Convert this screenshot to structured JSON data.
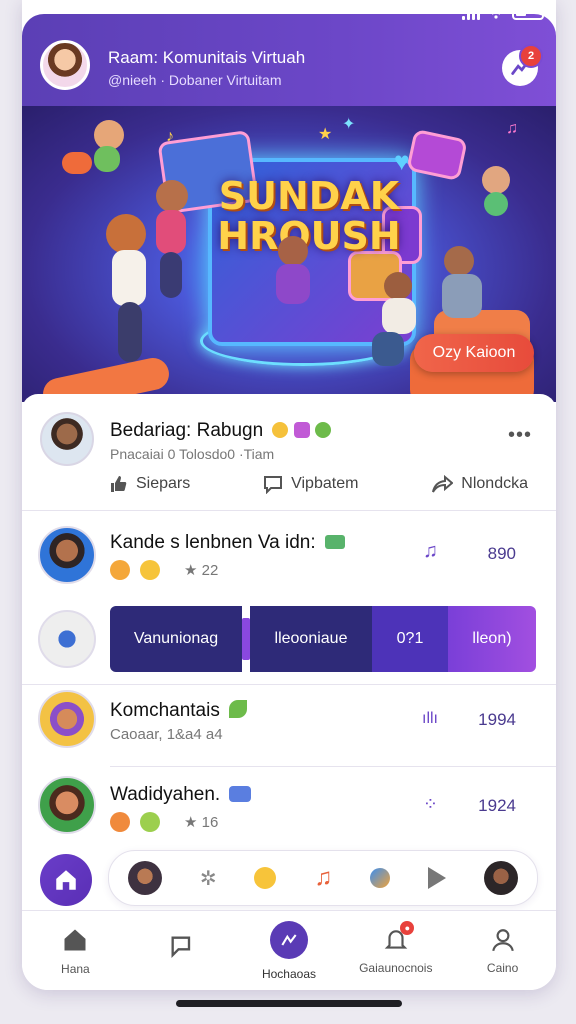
{
  "header": {
    "title": "Raam: Komunitais Virtuah",
    "subtitle": "@nieeh · Dobaner Virtuitam",
    "notification_count": "2"
  },
  "banner": {
    "title_line1": "SUNDAK",
    "title_line2": "HROUSH",
    "cta_label": "Ozy Kaioon"
  },
  "post": {
    "title": "Bedariag: Rabugn",
    "subtitle": "Pnacaiai 0 Tolosdo0 ·Tiam",
    "actions": [
      {
        "label": "Siepars",
        "icon": "thumbs-up-icon"
      },
      {
        "label": "Vipbatem",
        "icon": "comment-icon"
      },
      {
        "label": "Nlondcka",
        "icon": "share-icon"
      }
    ]
  },
  "rows": [
    {
      "title": "Kande s lenbnen Va idn:",
      "meta": "★ 22",
      "right": "890",
      "icon": "music-note-icon"
    },
    {
      "title": "Komchantais",
      "meta": "Caoaar, 1&a4 a4",
      "right": "1994",
      "icon": "equalizer-icon"
    },
    {
      "title": "Wadidyahen.",
      "meta": "★ 16",
      "right": "1924",
      "icon": "dots-icon"
    }
  ],
  "wide_bar": {
    "segments": [
      "Vanunionag",
      "lleooniaue",
      "0?1",
      "lleon)"
    ]
  },
  "nav": {
    "items": [
      {
        "label": "Hana"
      },
      {
        "label": ""
      },
      {
        "label": "Hochaoas"
      },
      {
        "label": "Gaiaunocnois"
      },
      {
        "label": "Caino"
      }
    ]
  },
  "colors": {
    "header": "#6c47c8",
    "accent": "#5a3bb5",
    "cta": "#e74b3b"
  }
}
